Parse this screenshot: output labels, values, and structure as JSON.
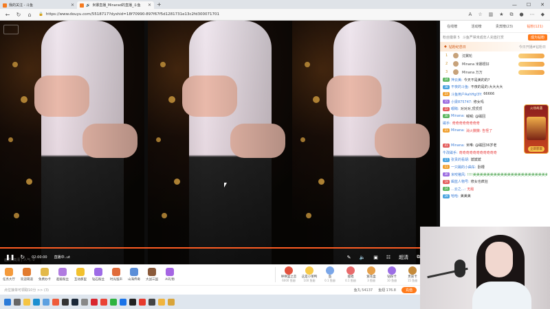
{
  "browser": {
    "tabs": [
      {
        "title": "我的关注 - 斗鱼",
        "active": false
      },
      {
        "title": "米娜直播_Minarad的直播_斗鱼",
        "active": true
      }
    ],
    "url": "https://www.douyu.com/5518717?dyshid=18f70990-897f67f5d1281731e13c2fd300071701"
  },
  "player": {
    "time": "02:00:00",
    "status": "直播中..ut",
    "info": "画质: 高清 | 人气: 0",
    "quality_label": "超清",
    "progress_color": "#ff5d23"
  },
  "gift_bar": {
    "left_items": [
      "任务大厅",
      "欢迎萌道",
      "免费办卡",
      "超级粉丝",
      "互动那里",
      "钻石粉丝",
      "时光留声",
      "山海传奇",
      "大战三国",
      "AI礼物"
    ],
    "right_items": [
      {
        "name": "呼唤里之恋",
        "sub": "6000 鱼翅"
      },
      {
        "name": "这是小莱鸭",
        "sub": "100 鱼翅"
      },
      {
        "name": "鱼",
        "sub": "0.1 鱼翅"
      },
      {
        "name": "能唱",
        "sub": "0.1 鱼翅"
      },
      {
        "name": "紫花盒",
        "sub": "3 鱼翅"
      },
      {
        "name": "钻粉卡",
        "sub": "10 鱼翅"
      },
      {
        "name": "贵族卡",
        "sub": "15 鱼翅"
      }
    ]
  },
  "status_bar": {
    "left": "点位接单可领取10分 >> (3)",
    "fish_balls": "鱼丸 54137",
    "fish_fins": "鱼翅 176.8",
    "charge": "充值"
  },
  "sidebar": {
    "tabs": [
      "在线榜",
      "活动榜",
      "贵宾榜(23)",
      "钻粉(121)"
    ],
    "active_tab": 3,
    "row_text": "粉丝徽章 5",
    "row_right": "斗鱼严禁未成年人充值打赏",
    "row_btn": "成为钻粉",
    "fan_day": "钻粉纪念日",
    "fan_day_right": "今日开播#钻粉日",
    "ranks": [
      {
        "n": "1",
        "name": "沈翼轮"
      },
      {
        "n": "2",
        "name": "Minana 米娜很好"
      },
      {
        "n": "3",
        "name": "Minana 万万"
      }
    ]
  },
  "chat": [
    {
      "lv": "24",
      "name": "萍云美:",
      "text": "今天不是美的的?"
    },
    {
      "lv": "38",
      "name": "不夜的斗鱼:",
      "text": "不夜的是的:大大大大"
    },
    {
      "lv": "23",
      "name": "斗鱼用户AahHgl3Y:",
      "text": "66666"
    },
    {
      "lv": "15",
      "name": "小梁875747:",
      "text": "修女吗"
    },
    {
      "lv": "22",
      "name": "眼睛:",
      "text": "对对对,顶顶顶"
    },
    {
      "lv": "30",
      "name": "Minana:",
      "text": "喊喊: @磁回"
    },
    {
      "lv": "",
      "name": "磁手:",
      "text": "奇奇奇奇奇奇奇奇",
      "hot": true
    },
    {
      "lv": "21",
      "name": "Minana:",
      "text": "消火撒撒: 告怪了",
      "hot": true
    },
    {
      "lv": "",
      "name": "",
      "text": ""
    },
    {
      "lv": "41",
      "name": "Minana:",
      "text": "米唯: @磁回36岁老"
    },
    {
      "lv": "",
      "name": "牛改磁手:",
      "text": "奇奇奇奇奇奇奇奇奇奇奇",
      "hot": true
    },
    {
      "lv": "17",
      "name": "张贵的看胡:",
      "text": "斌斌斌"
    },
    {
      "lv": "11",
      "name": "一只踢的小曲车:",
      "text": "卧槽"
    },
    {
      "lv": "30",
      "name": "米咬嗷风:",
      "text": "!!!!美美美美美美美美美美美美美美美美美美美美美美美美美美美美",
      "green": true
    },
    {
      "lv": "19",
      "name": "蝎蓝人物号:",
      "text": "修女也疯狂"
    },
    {
      "lv": "24",
      "name": "...云之...:",
      "text": "无敌",
      "hot": true
    },
    {
      "lv": "29",
      "name": "哈哈:",
      "text": "美美美"
    }
  ],
  "promo": {
    "title": "火场奇遇",
    "btn": "立即获取"
  },
  "colors": {
    "accent": "#ff5d23",
    "brand": "#ff7a1a"
  }
}
